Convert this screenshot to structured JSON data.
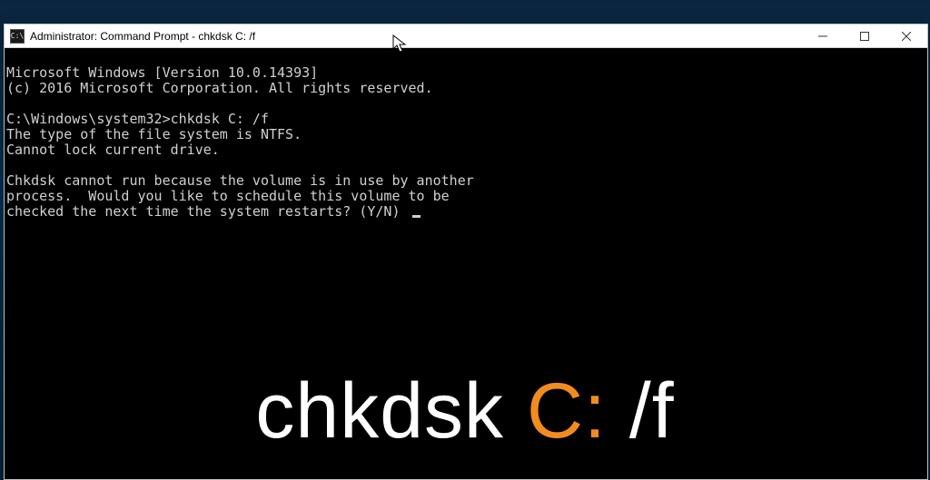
{
  "window": {
    "title": "Administrator: Command Prompt - chkdsk  C: /f",
    "icon_label": "C:\\"
  },
  "controls": {
    "minimize_label": "Minimize",
    "maximize_label": "Maximize",
    "close_label": "Close"
  },
  "terminal": {
    "version_line": "Microsoft Windows [Version 10.0.14393]",
    "copyright_line": "(c) 2016 Microsoft Corporation. All rights reserved.",
    "blank1": "",
    "prompt_path": "C:\\Windows\\system32>",
    "command": "chkdsk C: /f",
    "fs_type_line": "The type of the file system is NTFS.",
    "cannot_lock_line": "Cannot lock current drive.",
    "blank2": "",
    "msg_line1": "Chkdsk cannot run because the volume is in use by another",
    "msg_line2": "process.  Would you like to schedule this volume to be",
    "msg_line3": "checked the next time the system restarts? (Y/N) "
  },
  "overlay": {
    "part1": "chkdsk ",
    "part2": "C:",
    "part3": " /f"
  }
}
